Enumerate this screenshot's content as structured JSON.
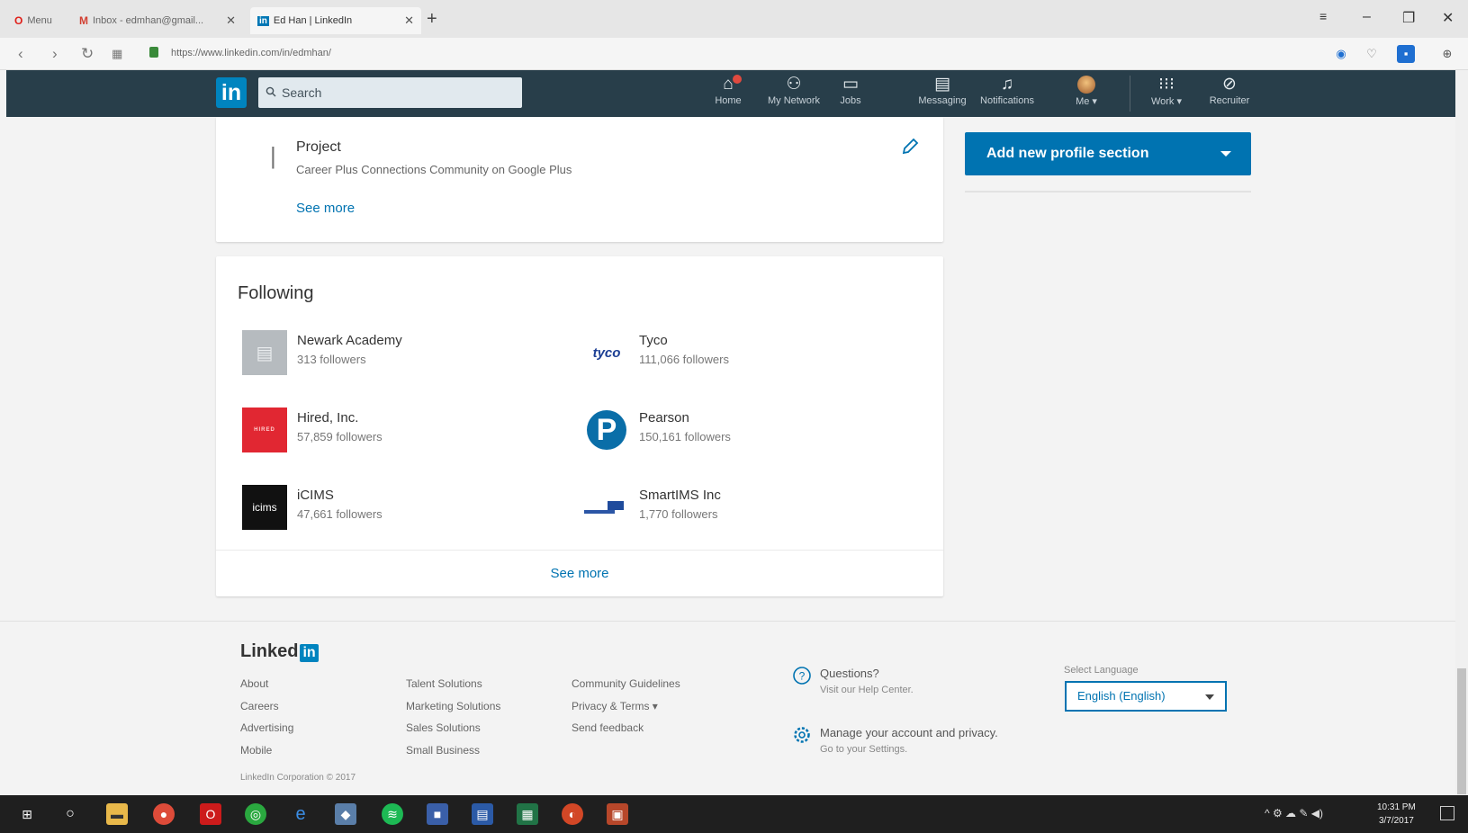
{
  "browser": {
    "tabs": [
      {
        "label": "Menu",
        "icon": "opera-icon"
      },
      {
        "label": "Inbox - edmhan@gmail...",
        "icon": "gmail-icon"
      },
      {
        "label": "Ed Han | LinkedIn",
        "icon": "linkedin-icon"
      }
    ],
    "url": "https://www.linkedin.com/in/edmhan/"
  },
  "nav": {
    "search_placeholder": "Search",
    "items": [
      {
        "label": "Home",
        "icon": "home-icon"
      },
      {
        "label": "My Network",
        "icon": "network-icon"
      },
      {
        "label": "Jobs",
        "icon": "briefcase-icon"
      },
      {
        "label": "Messaging",
        "icon": "messaging-icon"
      },
      {
        "label": "Notifications",
        "icon": "bell-icon"
      },
      {
        "label": "Me ▾",
        "icon": "avatar"
      },
      {
        "label": "Work ▾",
        "icon": "grid-icon"
      },
      {
        "label": "Recruiter",
        "icon": "recruiter-icon"
      }
    ]
  },
  "project": {
    "title": "Project",
    "description": "Career Plus Connections Community on Google Plus",
    "see_more": "See more"
  },
  "following": {
    "title": "Following",
    "items": [
      {
        "name": "Newark Academy",
        "followers": "313 followers"
      },
      {
        "name": "Tyco",
        "followers": "111,066 followers",
        "logo_text": "tyco"
      },
      {
        "name": "Hired, Inc.",
        "followers": "57,859 followers",
        "logo_text": "HIRED"
      },
      {
        "name": "Pearson",
        "followers": "150,161 followers",
        "logo_text": "P"
      },
      {
        "name": "iCIMS",
        "followers": "47,661 followers",
        "logo_text": "icims"
      },
      {
        "name": "SmartIMS Inc",
        "followers": "1,770 followers"
      }
    ],
    "see_more": "See more"
  },
  "sidebar": {
    "add_section": "Add new profile section"
  },
  "footer": {
    "logo_text": "Linked",
    "logo_in": "in",
    "col1": [
      "About",
      "Careers",
      "Advertising",
      "Mobile"
    ],
    "col2": [
      "Talent Solutions",
      "Marketing Solutions",
      "Sales Solutions",
      "Small Business"
    ],
    "col3": [
      "Community Guidelines",
      "Privacy & Terms ▾",
      "Send feedback"
    ],
    "copyright": "LinkedIn Corporation © 2017",
    "questions_title": "Questions?",
    "questions_sub": "Visit our Help Center.",
    "manage_title": "Manage your account and privacy.",
    "manage_sub": "Go to your Settings.",
    "language_label": "Select Language",
    "language_value": "English (English)"
  },
  "taskbar": {
    "time": "10:31 PM",
    "date": "3/7/2017"
  },
  "colors": {
    "linkedin_blue": "#0073b1",
    "nav_bg": "#283e4a"
  }
}
